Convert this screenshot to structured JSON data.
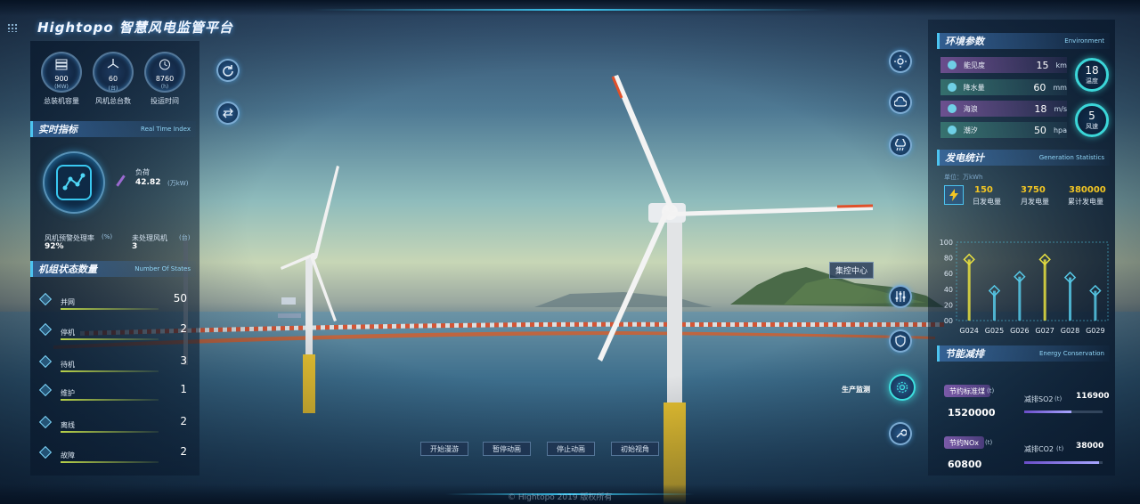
{
  "app": {
    "title": "Hightopo 智慧风电监管平台",
    "bottom_text": "© Hightopo 2019 版权所有"
  },
  "colors": {
    "accent": "#3bc6f0",
    "highlight": "#f3c623",
    "badge": "#3bd6d8"
  },
  "kpis": [
    {
      "icon": "server-icon",
      "value": "900",
      "unit": "(MW)",
      "label": "总装机容量"
    },
    {
      "icon": "wind-turbine-icon",
      "value": "60",
      "unit": "(台)",
      "label": "风机总台数"
    },
    {
      "icon": "clock-icon",
      "value": "8760",
      "unit": "(h)",
      "label": "投运时间"
    }
  ],
  "realtime": {
    "title": "实时指标",
    "subtitle": "Real Time Index",
    "load_label": "负荷",
    "load_value": "42.82",
    "load_unit": "(万kW)",
    "alarm_rate_label": "风机预警处理率",
    "alarm_rate_unit": "(%)",
    "alarm_rate_value": "92%",
    "unhandled_label": "未处理风机",
    "unhandled_unit": "(台)",
    "unhandled_value": "3"
  },
  "states": {
    "title": "机组状态数量",
    "subtitle": "Number Of States",
    "items": [
      {
        "label": "并网",
        "value": "50"
      },
      {
        "label": "停机",
        "value": "2"
      },
      {
        "label": "待机",
        "value": "3"
      },
      {
        "label": "维护",
        "value": "1"
      },
      {
        "label": "离线",
        "value": "2"
      },
      {
        "label": "故障",
        "value": "2"
      }
    ]
  },
  "environment": {
    "title": "环境参数",
    "subtitle": "Environment",
    "rows": [
      {
        "name": "能见度",
        "value": "15",
        "unit": "km"
      },
      {
        "name": "降水量",
        "value": "60",
        "unit": "mm"
      },
      {
        "name": "海浪",
        "value": "18",
        "unit": "m/s"
      },
      {
        "name": "潮汐",
        "value": "50",
        "unit": "hpa"
      }
    ],
    "temperature": {
      "value": "18",
      "label": "温度"
    },
    "wind_speed": {
      "value": "5",
      "label": "风速"
    }
  },
  "generation": {
    "title": "发电统计",
    "subtitle": "Generation Statistics",
    "unit_label": "单位：万kWh",
    "daily": {
      "value": "150",
      "label": "日发电量"
    },
    "monthly": {
      "value": "3750",
      "label": "月发电量"
    },
    "total": {
      "value": "380000",
      "label": "累计发电量"
    }
  },
  "chart_data": {
    "type": "line",
    "categories": [
      "G024",
      "G025",
      "G026",
      "G027",
      "G028",
      "G029"
    ],
    "values": [
      78,
      38,
      56,
      78,
      55,
      38
    ],
    "ylim": [
      0,
      100
    ],
    "yticks": [
      "100",
      "80",
      "60",
      "40",
      "20",
      "00"
    ],
    "grid": false
  },
  "energy": {
    "title": "节能减排",
    "subtitle": "Energy Conservation",
    "coal": {
      "label": "节约标准煤",
      "unit": "(t)",
      "value": "1520000"
    },
    "nox": {
      "label": "节约NOx",
      "unit": "(t)",
      "value": "60800"
    },
    "so2": {
      "label": "减排SO2",
      "unit": "(t)",
      "value": "116900",
      "fill": 0.6
    },
    "co2": {
      "label": "减排CO2",
      "unit": "(t)",
      "value": "38000",
      "fill": 0.95
    }
  },
  "scene": {
    "center_tag": "集控中心",
    "production_label": "生产监测",
    "buttons": [
      "开始漫游",
      "暂停动画",
      "停止动画",
      "初始视角"
    ]
  }
}
